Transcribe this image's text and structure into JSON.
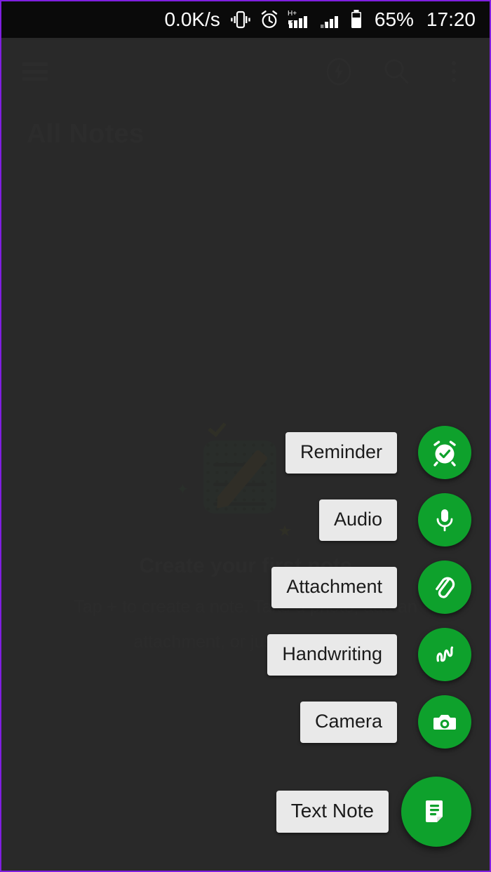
{
  "status_bar": {
    "net_speed": "0.0K/s",
    "icons": [
      "vibrate-icon",
      "alarm-icon",
      "signal-hplus-icon",
      "signal-icon",
      "battery-icon"
    ],
    "network_type": "H+",
    "battery_percent": "65%",
    "clock": "17:20"
  },
  "app_bar": {
    "menu_icon": "hamburger-menu-icon",
    "actions": [
      {
        "name": "quick-note-icon",
        "label": "Quick Note"
      },
      {
        "name": "search-icon",
        "label": "Search"
      },
      {
        "name": "overflow-menu-icon",
        "label": "More options"
      }
    ]
  },
  "page": {
    "title": "All Notes"
  },
  "empty_state": {
    "title": "Create your first note",
    "subtitle": "Tap + to create a note. Take a photo, add an attachment, or just write text.",
    "illustration": "note-and-pencil-illustration"
  },
  "speed_dial": {
    "accent_color": "#0ea12c",
    "label_bg": "#e9e9e9",
    "label_text_color": "#1b1b1b",
    "items": [
      {
        "label": "Reminder",
        "icon": "alarm-check-icon"
      },
      {
        "label": "Audio",
        "icon": "microphone-icon"
      },
      {
        "label": "Attachment",
        "icon": "paperclip-icon"
      },
      {
        "label": "Handwriting",
        "icon": "scribble-icon"
      },
      {
        "label": "Camera",
        "icon": "camera-icon"
      }
    ],
    "primary": {
      "label": "Text Note",
      "icon": "text-note-icon"
    }
  },
  "theme": {
    "scrim": "#303030",
    "background": "#303030",
    "status_bar_bg": "#0a0a0a",
    "border": "#7f1fe0"
  }
}
